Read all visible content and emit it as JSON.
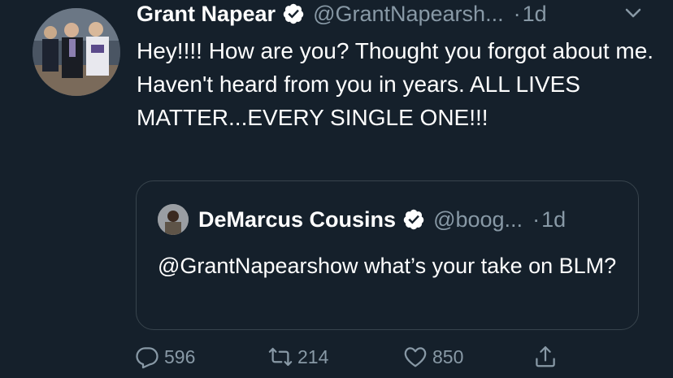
{
  "tweet": {
    "display_name": "Grant Napear",
    "handle": "@GrantNapearsh...",
    "separator": "·",
    "time": "1d",
    "text": "Hey!!!! How are you? Thought you forgot about me.  Haven't heard from you in years. ALL LIVES MATTER...EVERY SINGLE ONE!!!"
  },
  "quoted": {
    "display_name": "DeMarcus Cousins",
    "handle": "@boog...",
    "separator": "·",
    "time": "1d",
    "text": "@GrantNapearshow what’s your take on BLM?"
  },
  "actions": {
    "replies": "596",
    "retweets": "214",
    "likes": "850"
  },
  "colors": {
    "background": "#15202b",
    "secondary_text": "#8899a6",
    "border": "#38444d"
  },
  "icons": {
    "verified": "verified-badge-icon",
    "caret": "chevron-down-icon",
    "reply": "reply-icon",
    "retweet": "retweet-icon",
    "like": "heart-icon",
    "share": "share-icon"
  }
}
